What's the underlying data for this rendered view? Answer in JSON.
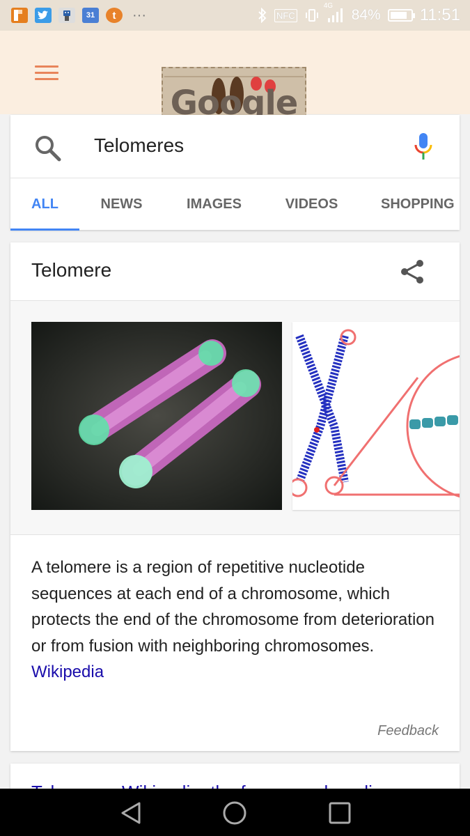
{
  "status_bar": {
    "notification_icons": [
      "flipboard-icon",
      "twitter-icon",
      "robot-app-icon",
      "calendar-icon",
      "tumblr-icon"
    ],
    "calendar_day": "31",
    "tumblr_letter": "t",
    "overflow": "···",
    "network": "4G",
    "nfc": "NFC",
    "battery_percent": "84%",
    "battery_level": 0.84,
    "time": "11:51"
  },
  "header": {
    "doodle_text": "Google"
  },
  "search": {
    "query": "Telomeres",
    "tabs": [
      {
        "label": "ALL",
        "active": true
      },
      {
        "label": "NEWS",
        "active": false
      },
      {
        "label": "IMAGES",
        "active": false
      },
      {
        "label": "VIDEOS",
        "active": false
      },
      {
        "label": "SHOPPING",
        "active": false
      }
    ]
  },
  "knowledge_card": {
    "title": "Telomere",
    "description": "A telomere is a region of repetitive nucleotide sequences at each end of a chromosome, which protects the end of the chromosome from deterioration or from fusion with neighboring chromosomes.",
    "source_link": "Wikipedia",
    "feedback": "Feedback"
  },
  "next_result": {
    "title": "Telomere - Wikipedia, the free encyclopedia"
  },
  "colors": {
    "accent": "#4285f4",
    "link": "#1a0dab",
    "menu": "#e8845a"
  }
}
